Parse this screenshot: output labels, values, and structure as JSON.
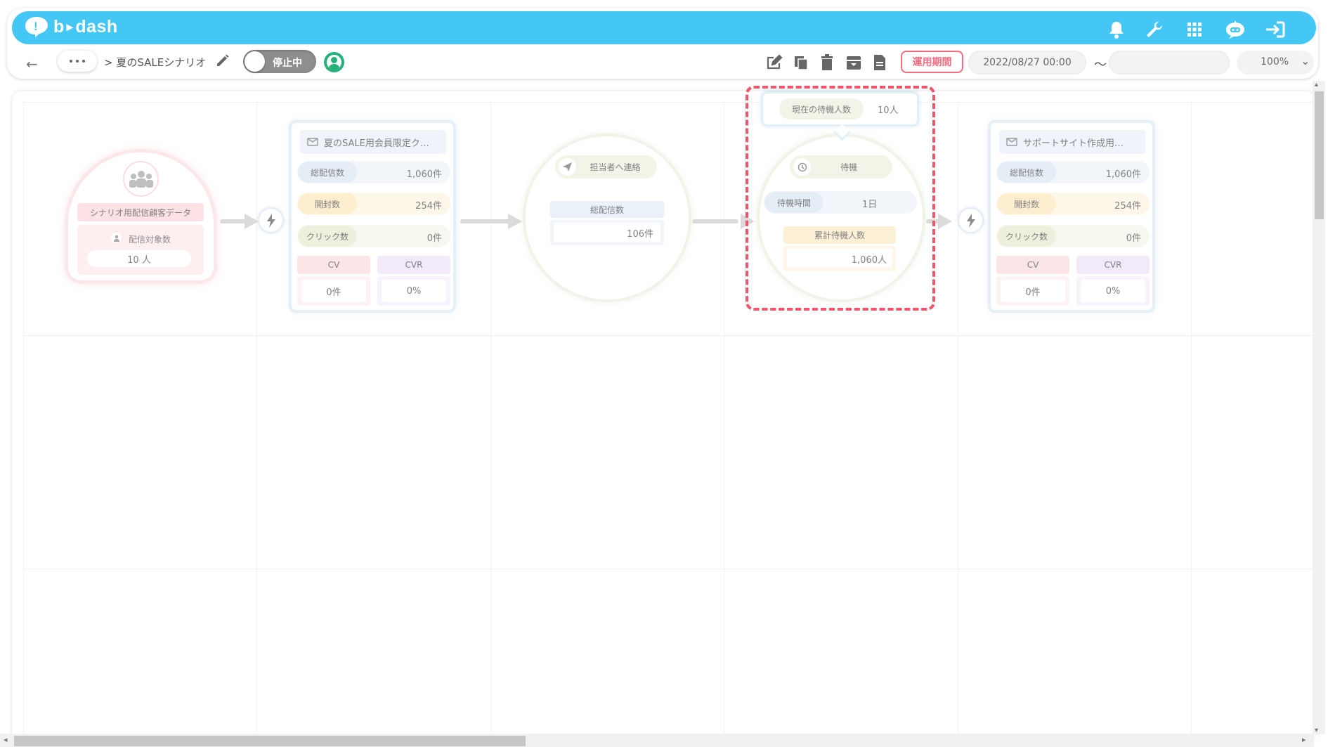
{
  "header": {
    "brand": "b-dash",
    "icons": [
      "bell-icon",
      "wrench-icon",
      "grid-icon",
      "robot-icon",
      "logout-icon"
    ]
  },
  "subbar": {
    "back_icon": "←",
    "more_label": "•••",
    "breadcrumb": "> 夏のSALEシナリオ",
    "status_toggle": "停止中",
    "period_label": "運用期間",
    "start_date": "2022/08/27 00:00",
    "tilde": "〜",
    "end_date": "",
    "zoom": "100%"
  },
  "nodes": {
    "segment": {
      "title": "シナリオ用配信顧客データ",
      "target_label": "配信対象数",
      "target_value": "10 人"
    },
    "mail1": {
      "title": "夏のSALE用会員限定ク…",
      "sent_label": "総配信数",
      "sent_value": "1,060件",
      "open_label": "開封数",
      "open_value": "254件",
      "click_label": "クリック数",
      "click_value": "0件",
      "cv_label": "CV",
      "cv_value": "0件",
      "cvr_label": "CVR",
      "cvr_value": "0%"
    },
    "notify": {
      "title": "担当者へ連絡",
      "sent_label": "総配信数",
      "sent_value": "106件"
    },
    "wait": {
      "current_label": "現在の待機人数",
      "current_value": "10人",
      "title": "待機",
      "time_label": "待機時間",
      "time_value": "1日",
      "cumulative_label": "累計待機人数",
      "cumulative_value": "1,060人"
    },
    "mail2": {
      "title": "サポートサイト作成用…",
      "sent_label": "総配信数",
      "sent_value": "1,060件",
      "open_label": "開封数",
      "open_value": "254件",
      "click_label": "クリック数",
      "click_value": "0件",
      "cv_label": "CV",
      "cv_value": "0件",
      "cvr_label": "CVR",
      "cvr_value": "0%"
    }
  },
  "colors": {
    "header": "#44c7f4",
    "accent_red": "#f0566b",
    "toggle_off": "#8e8e8e",
    "avatar_green": "#25b27a"
  }
}
